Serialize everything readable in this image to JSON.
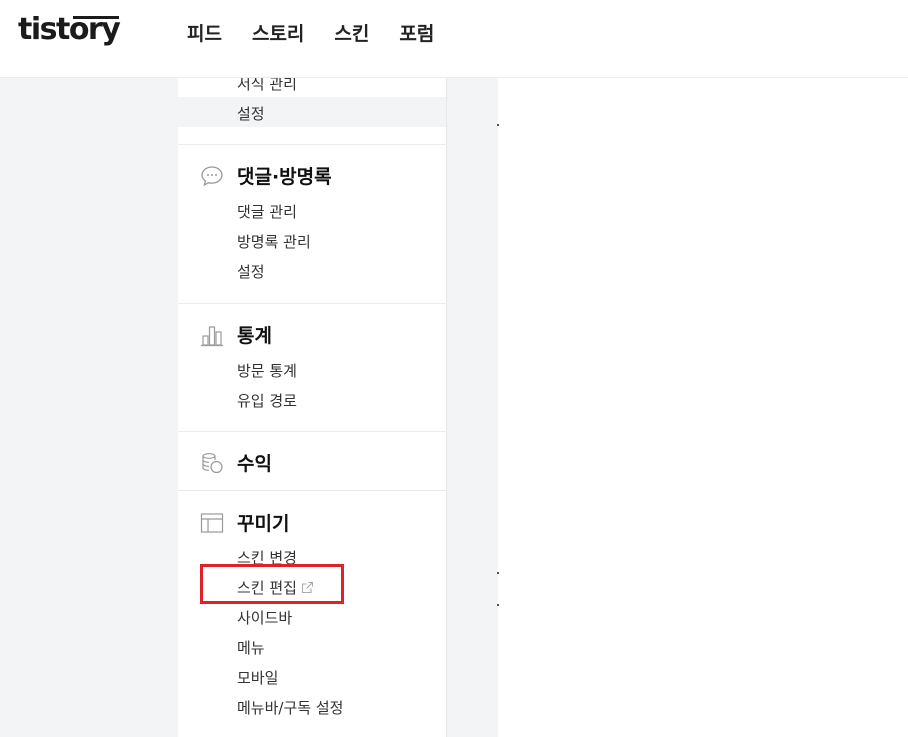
{
  "header": {
    "logo": "tistory",
    "nav": [
      "피드",
      "스토리",
      "스킨",
      "포럼"
    ]
  },
  "sidebar": {
    "post_section": {
      "items": [
        "서식 관리",
        "설정"
      ]
    },
    "comment_section": {
      "title": "댓글·방명록",
      "icon": "speech-bubble-icon",
      "items": [
        "댓글 관리",
        "방명록 관리",
        "설정"
      ]
    },
    "stats_section": {
      "title": "통계",
      "icon": "bar-chart-icon",
      "items": [
        "방문 통계",
        "유입 경로"
      ]
    },
    "revenue_section": {
      "title": "수익",
      "icon": "coins-icon"
    },
    "decorate_section": {
      "title": "꾸미기",
      "icon": "layout-icon",
      "items": [
        "스킨 변경",
        "스킨 편집",
        "사이드바",
        "메뉴",
        "모바일",
        "메뉴바/구독 설정"
      ]
    }
  },
  "colors": {
    "highlight": "#e0202a",
    "active_bg": "#f3f4f6"
  }
}
